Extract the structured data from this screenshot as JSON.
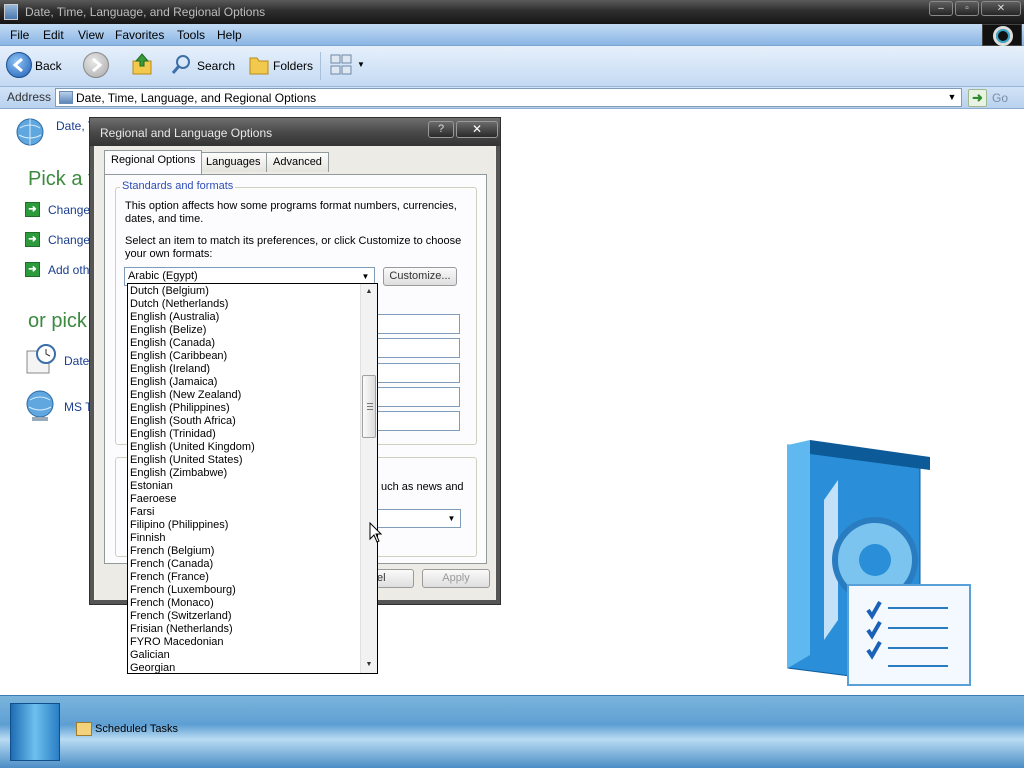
{
  "window": {
    "title": "Date, Time, Language, and Regional Options"
  },
  "menu": [
    "File",
    "Edit",
    "View",
    "Favorites",
    "Tools",
    "Help"
  ],
  "toolbar": {
    "back": "Back",
    "search": "Search",
    "folders": "Folders"
  },
  "address": {
    "label": "Address",
    "value": "Date, Time, Language, and Regional Options",
    "go": "Go"
  },
  "content": {
    "header": "Date, T",
    "pick_task": "Pick a t",
    "links": [
      "Change",
      "Change",
      "Add othe"
    ],
    "or_pick": "or pick",
    "icons": [
      "Date",
      "MS T"
    ]
  },
  "dialog": {
    "title": "Regional and Language Options",
    "help": "?",
    "close": "✕",
    "tabs": [
      "Regional Options",
      "Languages",
      "Advanced"
    ],
    "group_title": "Standards and formats",
    "description": "This option affects how some programs format numbers, currencies, dates, and time.",
    "instruction": "Select an item to match its preferences, or click Customize to choose your own formats:",
    "selected_format": "Arabic (Egypt)",
    "customize": "Customize...",
    "location_partial": "uch as news and",
    "cancel_partial": "el",
    "apply": "Apply"
  },
  "language_list": [
    "Dutch (Belgium)",
    "Dutch (Netherlands)",
    "English (Australia)",
    "English (Belize)",
    "English (Canada)",
    "English (Caribbean)",
    "English (Ireland)",
    "English (Jamaica)",
    "English (New Zealand)",
    "English (Philippines)",
    "English (South Africa)",
    "English (Trinidad)",
    "English (United Kingdom)",
    "English (United States)",
    "English (Zimbabwe)",
    "Estonian",
    "Faeroese",
    "Farsi",
    "Filipino (Philippines)",
    "Finnish",
    "French (Belgium)",
    "French (Canada)",
    "French (France)",
    "French (Luxembourg)",
    "French (Monaco)",
    "French (Switzerland)",
    "Frisian (Netherlands)",
    "FYRO Macedonian",
    "Galician",
    "Georgian"
  ],
  "taskbar": {
    "item": "Scheduled Tasks"
  },
  "colors": {
    "accent_green": "#3b8a3e",
    "link_blue": "#1a3e8e",
    "dialog_title": "#4a4a4a"
  }
}
